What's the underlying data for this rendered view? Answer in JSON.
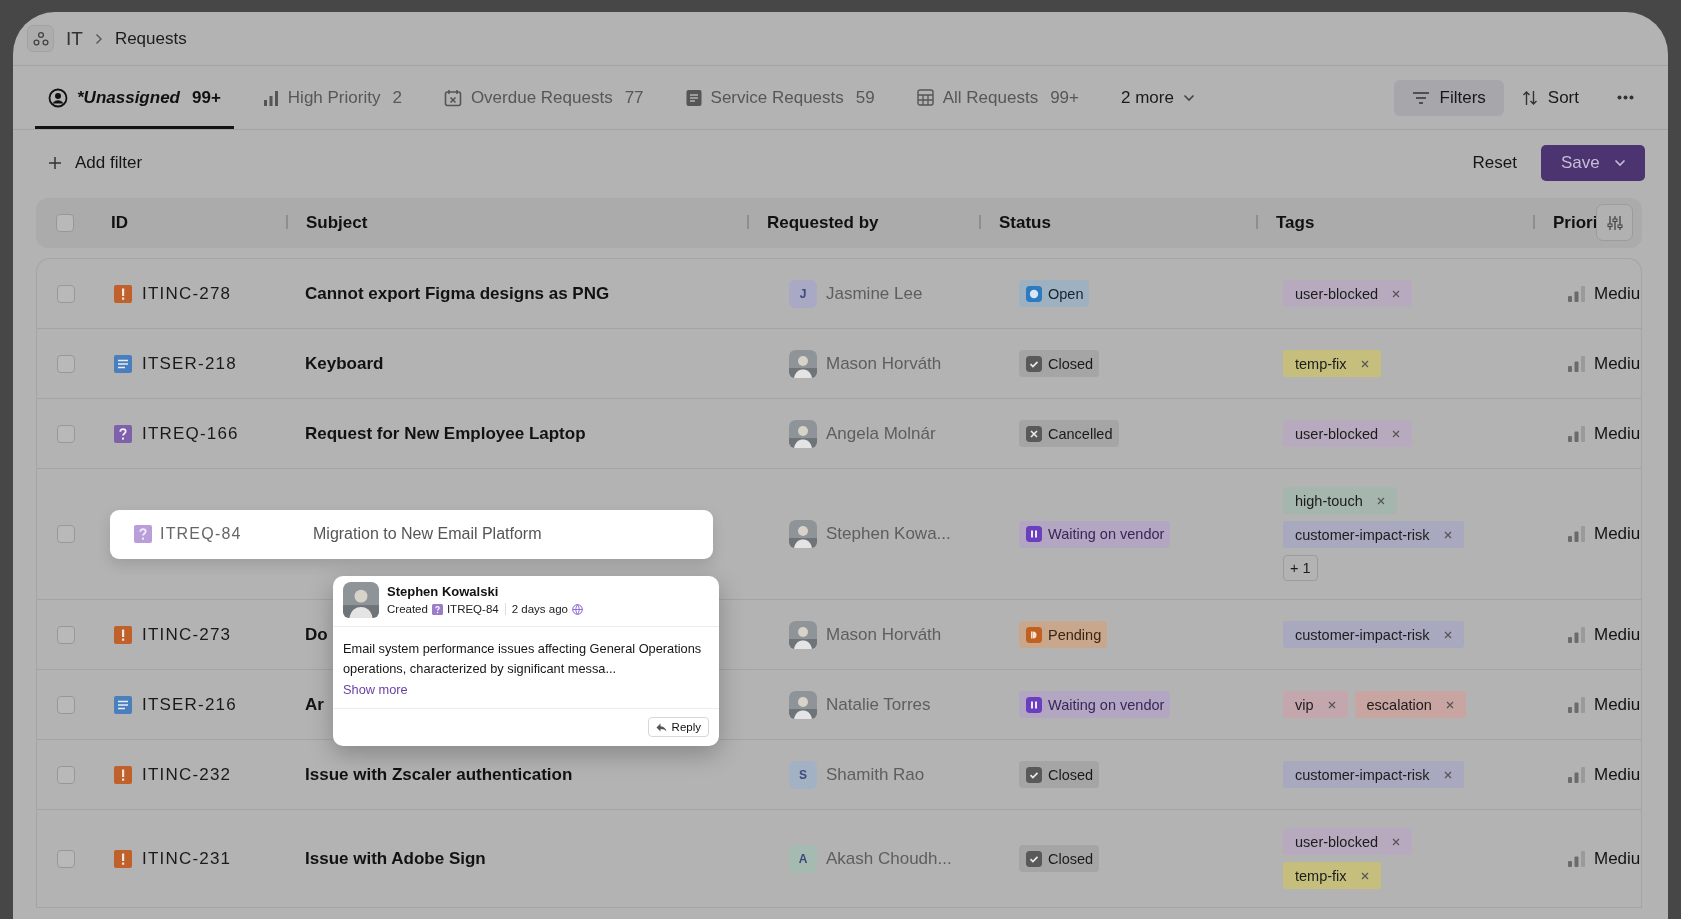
{
  "breadcrumb": {
    "items": [
      {
        "label": "IT"
      },
      {
        "label": "Requests"
      }
    ]
  },
  "tabs": [
    {
      "kind": "user",
      "label": "*Unassigned",
      "count": "99+",
      "selected": true,
      "unsaved": true
    },
    {
      "kind": "bars",
      "label": "High Priority",
      "count": "2",
      "selected": false,
      "unsaved": false
    },
    {
      "kind": "calendar",
      "label": "Overdue Requests",
      "count": "77",
      "selected": false,
      "unsaved": false
    },
    {
      "kind": "document",
      "label": "Service Requests",
      "count": "59",
      "selected": false,
      "unsaved": false
    },
    {
      "kind": "grid",
      "label": "All Requests",
      "count": "99+",
      "selected": false,
      "unsaved": false
    },
    {
      "kind": "more",
      "label": "2 more",
      "selected": false,
      "unsaved": false
    }
  ],
  "toolbar": {
    "filters": {
      "label": "Filters",
      "active": true
    },
    "sort": {
      "label": "Sort"
    }
  },
  "filter_bar": {
    "add_filter": "Add filter",
    "reset": "Reset",
    "save": "Save"
  },
  "table": {
    "columns": [
      "ID",
      "Subject",
      "Requested by",
      "Status",
      "Tags",
      "Priori"
    ],
    "header_checked": false,
    "rows": [
      {
        "checked": false,
        "highlighted": false,
        "kind": "incident",
        "id": "ITINC-278",
        "subject": "Cannot export Figma designs as PNG",
        "requester": {
          "kind": "initial",
          "initial": "J",
          "color": "#a9a9c6",
          "name": "Jasmine Lee"
        },
        "status": {
          "kind": "open",
          "label": "Open"
        },
        "tags": [
          [
            {
              "kind": "tag",
              "label": "user-blocked",
              "color": "#b7aabe"
            }
          ]
        ],
        "priority": "Mediu"
      },
      {
        "checked": false,
        "highlighted": false,
        "kind": "service",
        "id": "ITSER-218",
        "subject": "Keyboard",
        "requester": {
          "kind": "photo",
          "name": "Mason Horváth"
        },
        "status": {
          "kind": "closed",
          "label": "Closed"
        },
        "tags": [
          [
            {
              "kind": "tag",
              "label": "temp-fix",
              "color": "#c6be7c"
            }
          ]
        ],
        "priority": "Mediu"
      },
      {
        "checked": false,
        "highlighted": false,
        "kind": "request",
        "id": "ITREQ-166",
        "subject": "Request for New Employee Laptop",
        "requester": {
          "kind": "photo",
          "name": "Angela Molnár"
        },
        "status": {
          "kind": "cancelled",
          "label": "Cancelled"
        },
        "tags": [
          [
            {
              "kind": "tag",
              "label": "user-blocked",
              "color": "#b7aabe"
            }
          ]
        ],
        "priority": "Mediu"
      },
      {
        "checked": false,
        "highlighted": true,
        "kind": "request",
        "id": "ITREQ-84",
        "subject": "Migration to New Email Platform",
        "requester": {
          "kind": "photo",
          "name": "Stephen Kowa..."
        },
        "status": {
          "kind": "waiting",
          "label": "Waiting on vendor"
        },
        "tags": [
          [
            {
              "kind": "tag",
              "label": "high-touch",
              "color": "#a4b6ae"
            }
          ],
          [
            {
              "kind": "tag",
              "label": "customer-impact-risk",
              "color": "#a8a8bf"
            }
          ],
          [
            {
              "kind": "more",
              "label": "+ 1"
            }
          ]
        ],
        "priority": "Mediu"
      },
      {
        "checked": false,
        "highlighted": false,
        "kind": "incident",
        "id": "ITINC-273",
        "subject": "Do",
        "requester": {
          "kind": "photo",
          "name": "Mason Horváth"
        },
        "status": {
          "kind": "pending",
          "label": "Pending"
        },
        "tags": [
          [
            {
              "kind": "tag",
              "label": "customer-impact-risk",
              "color": "#a8a8bf"
            }
          ]
        ],
        "priority": "Mediu"
      },
      {
        "checked": false,
        "highlighted": false,
        "kind": "service",
        "id": "ITSER-216",
        "subject": "Ar",
        "requester": {
          "kind": "photo",
          "name": "Natalie Torres"
        },
        "status": {
          "kind": "waiting",
          "label": "Waiting on vendor"
        },
        "tags": [
          [
            {
              "kind": "tag",
              "label": "vip",
              "color": "#c4a6ad"
            },
            {
              "kind": "tag",
              "label": "escalation",
              "color": "#c8a5a1"
            }
          ]
        ],
        "priority": "Mediu"
      },
      {
        "checked": false,
        "highlighted": false,
        "kind": "incident",
        "id": "ITINC-232",
        "subject": "Issue with Zscaler authentication",
        "requester": {
          "kind": "initial",
          "initial": "S",
          "color": "#a3b1c4",
          "name": "Shamith Rao"
        },
        "status": {
          "kind": "closed",
          "label": "Closed"
        },
        "tags": [
          [
            {
              "kind": "tag",
              "label": "customer-impact-risk",
              "color": "#a8a8bf"
            }
          ]
        ],
        "priority": "Mediu"
      },
      {
        "checked": false,
        "highlighted": false,
        "kind": "incident",
        "id": "ITINC-231",
        "subject": "Issue with Adobe Sign",
        "requester": {
          "kind": "initial",
          "initial": "A",
          "color": "#a5bab1",
          "name": "Akash Choudh..."
        },
        "status": {
          "kind": "closed",
          "label": "Closed"
        },
        "tags": [
          [
            {
              "kind": "tag",
              "label": "user-blocked",
              "color": "#b7aabe"
            }
          ],
          [
            {
              "kind": "tag",
              "label": "temp-fix",
              "color": "#c6be7c"
            }
          ]
        ],
        "priority": "Mediu"
      }
    ]
  },
  "popover": {
    "author": "Stephen Kowalski",
    "action": "Created",
    "ref": "ITREQ-84",
    "time": "2 days ago",
    "body": "Email system performance issues affecting General Operations operations, characterized by significant messa...",
    "link": "Show more",
    "reply": "Reply"
  }
}
